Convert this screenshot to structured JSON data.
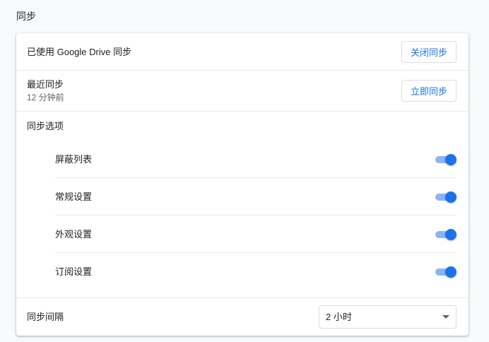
{
  "section": {
    "title": "同步"
  },
  "drive": {
    "label": "已使用 Google Drive 同步",
    "button_label": "关闭同步"
  },
  "recent": {
    "label": "最近同步",
    "time": "12 分钟前",
    "button_label": "立即同步"
  },
  "options": {
    "label": "同步选项",
    "items": [
      {
        "label": "屏蔽列表",
        "enabled": true
      },
      {
        "label": "常规设置",
        "enabled": true
      },
      {
        "label": "外观设置",
        "enabled": true
      },
      {
        "label": "订阅设置",
        "enabled": true
      }
    ]
  },
  "interval": {
    "label": "同步间隔",
    "selected": "2 小时"
  },
  "colors": {
    "accent": "#1a73e8",
    "toggle_track": "#8ab4f8",
    "divider": "#e8eaed",
    "background": "#f8f9fa"
  }
}
